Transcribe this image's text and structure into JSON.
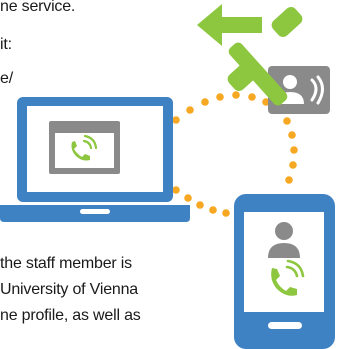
{
  "text": {
    "line1": "ne service.",
    "line2": "it:",
    "line3": "e/",
    "line4": " the staff member is",
    "line5": "University of Vienna",
    "line6": "ne profile, as well as"
  },
  "icons": {
    "laptop": "laptop-icon",
    "laptop_screen_call": "phone-call-icon",
    "smartphone": "smartphone-icon",
    "smartphone_person": "person-icon",
    "smartphone_call": "phone-call-icon",
    "handset": "phone-handset-icon",
    "forward_arrow": "arrow-left-icon",
    "contact_card": "contact-card-icon",
    "connector": "dotted-connection-line"
  },
  "colors": {
    "blue": "#3f82c4",
    "green": "#8dc63f",
    "orange": "#f7a823",
    "gray": "#8a8a8a",
    "screen_bg": "#ffffff"
  }
}
